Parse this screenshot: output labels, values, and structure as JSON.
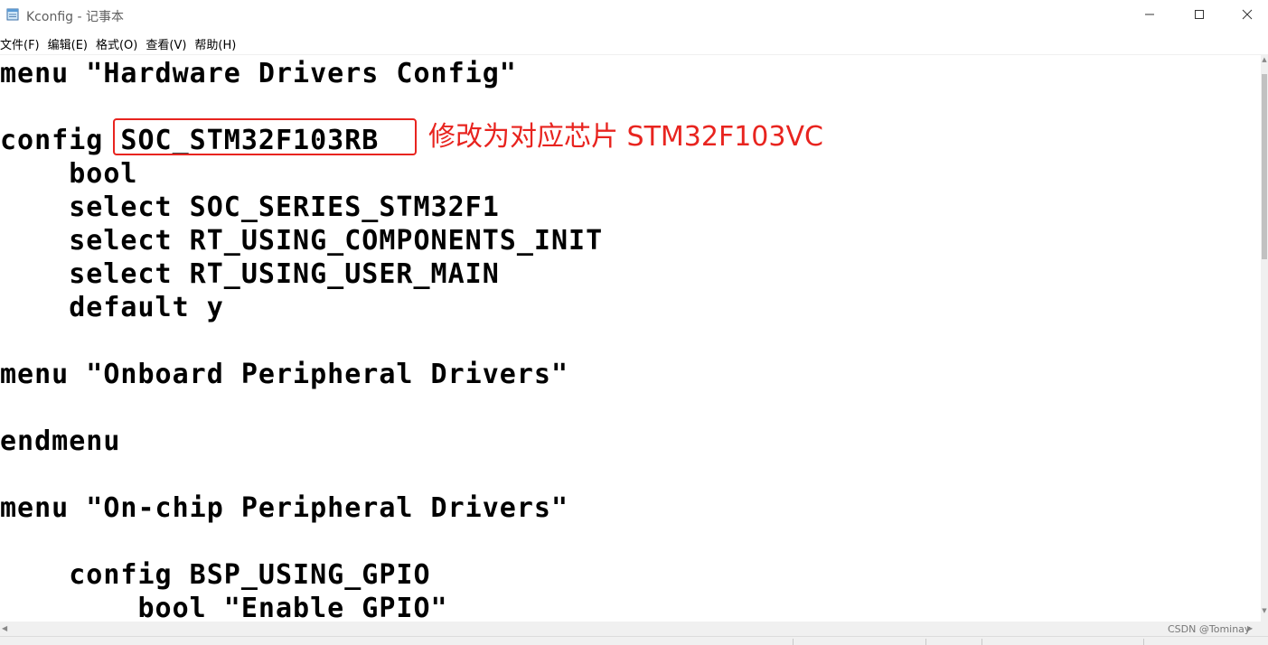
{
  "window": {
    "title": "Kconfig - 记事本",
    "icon": "notepad-icon",
    "controls": [
      "minimize-icon",
      "maximize-icon",
      "close-icon"
    ]
  },
  "menu": {
    "items": [
      "文件(F)",
      "编辑(E)",
      "格式(O)",
      "查看(V)",
      "帮助(H)"
    ]
  },
  "editor": {
    "lines": [
      "menu \"Hardware Drivers Config\"",
      "",
      "config SOC_STM32F103RB",
      "    bool",
      "    select SOC_SERIES_STM32F1",
      "    select RT_USING_COMPONENTS_INIT",
      "    select RT_USING_USER_MAIN",
      "    default y",
      "",
      "menu \"Onboard Peripheral Drivers\"",
      "",
      "endmenu",
      "",
      "menu \"On-chip Peripheral Drivers\"",
      "",
      "    config BSP_USING_GPIO",
      "        bool \"Enable GPIO\""
    ]
  },
  "annotation": {
    "text": "修改为对应芯片 STM32F103VC",
    "color": "#e8241f"
  },
  "watermark": {
    "text": "CSDN @Tominay"
  }
}
